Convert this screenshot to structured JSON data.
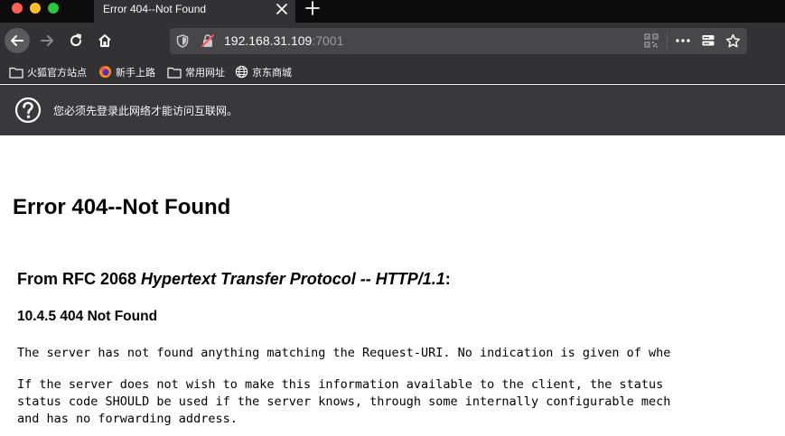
{
  "window": {
    "controls": [
      "close",
      "minimize",
      "zoom"
    ]
  },
  "tab": {
    "title": "Error 404--Not Found",
    "close_icon": "close-icon",
    "new_tab_icon": "plus-icon"
  },
  "navbar": {
    "url_host": "192.168.31.109",
    "url_port": ":7001"
  },
  "bookmarks": [
    {
      "label": "火狐官方站点",
      "icon": "folder-icon"
    },
    {
      "label": "新手上路",
      "icon": "firefox-icon"
    },
    {
      "label": "常用网址",
      "icon": "folder-icon"
    },
    {
      "label": "京东商城",
      "icon": "globe-icon"
    }
  ],
  "notification": {
    "icon": "question-icon",
    "text": "您必须先登录此网络才能访问互联网。"
  },
  "page": {
    "heading": "Error 404--Not Found",
    "rfc_prefix": "From RFC 2068 ",
    "rfc_title": "Hypertext Transfer Protocol -- HTTP/1.1",
    "rfc_suffix": ":",
    "section": "10.4.5 404 Not Found",
    "para1": "The server has not found anything matching the Request-URI. No indication is given of whe",
    "para2_lines": [
      "If the server does not wish to make this information available to the client, the status",
      "status code SHOULD be used if the server knows, through some internally configurable mech",
      "and has no forwarding address."
    ]
  },
  "colors": {
    "tabstrip_bg": "#0c0c0d",
    "toolbar_bg": "#323234",
    "urlbar_bg": "#474749",
    "notification_bg": "#38383d",
    "text_light": "#f9f9fa"
  }
}
